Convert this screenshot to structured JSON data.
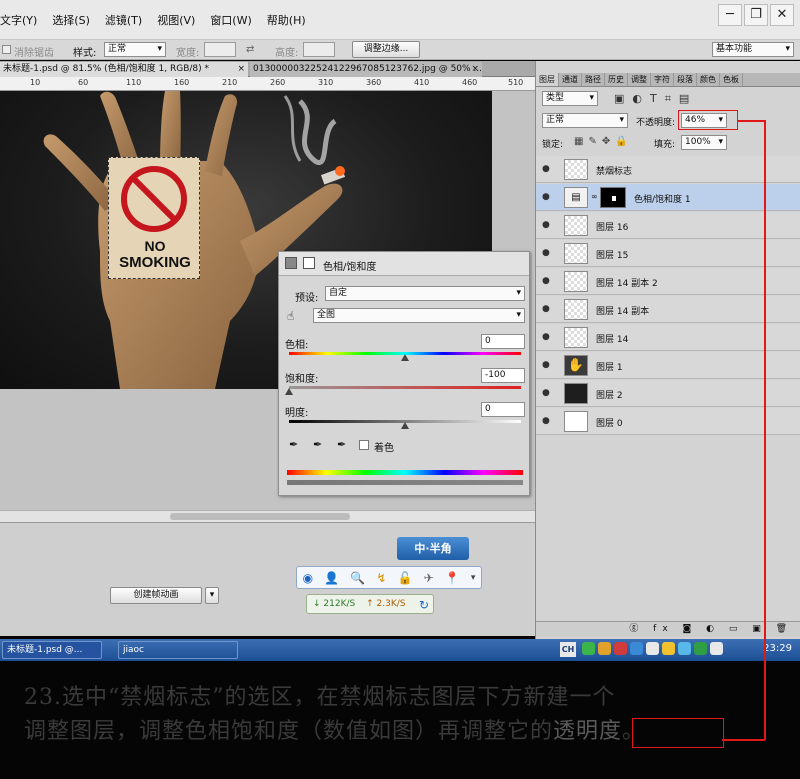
{
  "menu": {
    "items": [
      "文字(Y)",
      "选择(S)",
      "滤镜(T)",
      "视图(V)",
      "窗口(W)",
      "帮助(H)"
    ],
    "window_buttons": [
      "─",
      "❐",
      "✕"
    ]
  },
  "options": {
    "antialias_label": "消除锯齿",
    "style_label": "样式:",
    "style_value": "正常",
    "width_label": "宽度:",
    "height_label": "高度:",
    "refine_button": "调整边缘...",
    "workspace": "基本功能"
  },
  "doc_tabs": [
    {
      "label": "未标题-1.psd @ 81.5% (色相/饱和度 1, RGB/8) *",
      "close": "×"
    },
    {
      "label": "01300000322524122967085123762.jpg @ 50% ...",
      "close": "×"
    }
  ],
  "ruler_ticks": [
    "10",
    "60",
    "110",
    "160",
    "210",
    "260",
    "310",
    "360",
    "410",
    "460",
    "510"
  ],
  "sign": {
    "line1": "NO",
    "line2": "SMOKING"
  },
  "hue_sat": {
    "title": "色相/饱和度",
    "preset_label": "预设:",
    "preset_value": "自定",
    "range_value": "全图",
    "hue_label": "色相:",
    "hue_value": "0",
    "hue": 0,
    "saturation_label": "饱和度:",
    "saturation_value": "-100",
    "saturation": -100,
    "lightness_label": "明度:",
    "lightness_value": "0",
    "lightness": 0,
    "colorize_label": "着色"
  },
  "ime": {
    "label": "中·半角"
  },
  "net_toolbar": {
    "icons": [
      "◉",
      "👤",
      "🔍",
      "↯",
      "🔓",
      "✈",
      "📍",
      "▾"
    ]
  },
  "speed": {
    "down": "↓ 212K/S",
    "up": "↑ 2.3K/S"
  },
  "frame_anim_button": "创建帧动画",
  "panel": {
    "tabs": [
      "图层",
      "通道",
      "路径",
      "历史",
      "调整",
      "字符",
      "段落",
      "颜色",
      "色板"
    ],
    "filter_label": "类型",
    "blend_mode": "正常",
    "opacity_label": "不透明度:",
    "opacity_value": "46%",
    "lock_label": "锁定:",
    "fill_label": "填充:",
    "fill_value": "100%",
    "layers": [
      {
        "name": "禁烟标志",
        "thumb": "transparent",
        "selected": false
      },
      {
        "name": "色相/饱和度 1",
        "thumb": "adjustment",
        "selected": true
      },
      {
        "name": "图层 16",
        "thumb": "transparent",
        "selected": false
      },
      {
        "name": "图层 15",
        "thumb": "transparent",
        "selected": false
      },
      {
        "name": "图层 14 副本 2",
        "thumb": "transparent",
        "selected": false
      },
      {
        "name": "图层 14 副本",
        "thumb": "transparent",
        "selected": false
      },
      {
        "name": "图层 14",
        "thumb": "transparent",
        "selected": false
      },
      {
        "name": "图层 1",
        "thumb": "hand",
        "selected": false
      },
      {
        "name": "图层 2",
        "thumb": "dark",
        "selected": false
      },
      {
        "name": "图层 0",
        "thumb": "white",
        "selected": false
      }
    ],
    "bottom_icons": "ⓖ fx ◙ ◐ ▭ ▣ 🗑"
  },
  "taskbar": {
    "tasks": [
      "未标题-1.psd @...",
      "jiaoc"
    ],
    "lang": "CH",
    "clock": "23:29"
  },
  "caption": {
    "line1": "23.选中“禁烟标志”的选区，在禁烟标志图层下方新建一个",
    "line2_a": "调整图层，调整色相饱和度（数值如图）再调整它的",
    "line2_b": "透明度",
    "line2_c": "。"
  },
  "colors": {
    "accent": "#e01818",
    "selected_layer": "#bcd0ec",
    "taskbar": "#2a5ea8"
  }
}
